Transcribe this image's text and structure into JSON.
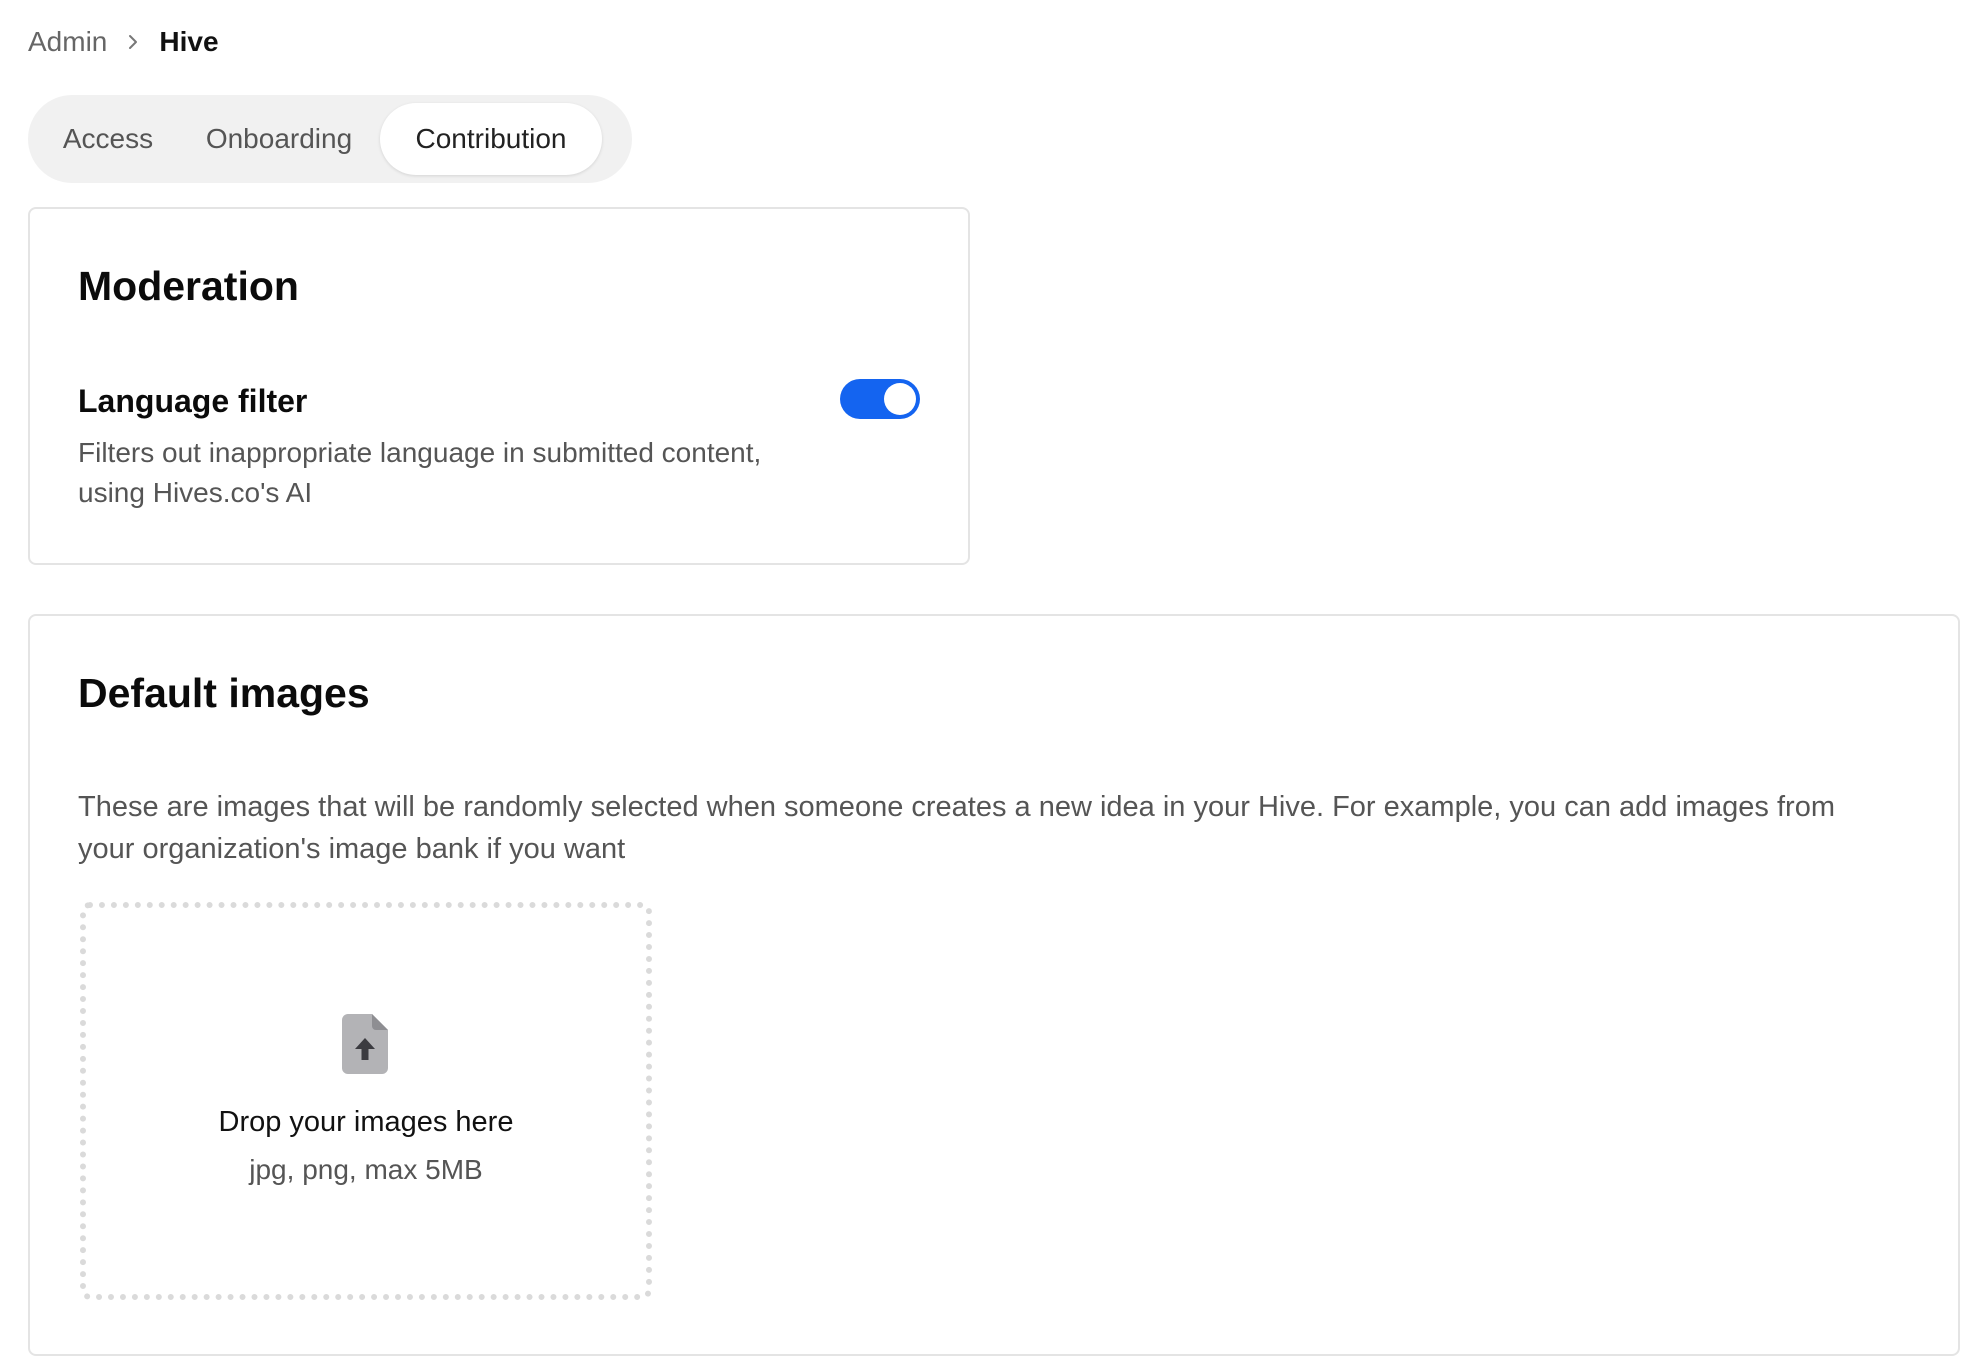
{
  "breadcrumb": {
    "parent": "Admin",
    "current": "Hive"
  },
  "tabs": [
    {
      "label": "Access",
      "selected": false
    },
    {
      "label": "Onboarding",
      "selected": false
    },
    {
      "label": "Contribution",
      "selected": true
    }
  ],
  "moderation": {
    "title": "Moderation",
    "language_filter": {
      "title": "Language filter",
      "description": "Filters out inappropriate language in submitted content, using Hives.co's AI",
      "enabled": true
    }
  },
  "default_images": {
    "title": "Default images",
    "description": "These are images that will be randomly selected when someone creates a new idea in your Hive. For example, you can add images from your organization's image bank if you want",
    "dropzone": {
      "icon": "file-upload-icon",
      "title": "Drop your images here",
      "subtitle": "jpg, png, max 5MB"
    }
  },
  "colors": {
    "accent": "#1464f0",
    "tabs_background": "#f1f1f1",
    "border": "#e4e4e4"
  }
}
